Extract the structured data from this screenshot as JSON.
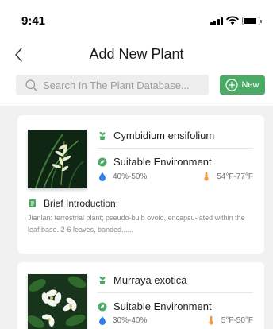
{
  "status_bar": {
    "time": "9:41"
  },
  "header": {
    "title": "Add New Plant",
    "search_placeholder": "Search In The Plant Database...",
    "new_button_label": "New"
  },
  "colors": {
    "accent_green": "#4aaa66",
    "water_blue": "#2f80ed",
    "temp_orange": "#f2994a"
  },
  "icons": {
    "back": "chevron-left-icon",
    "search": "search-icon",
    "new": "plus-circle-icon",
    "plant": "plant-pot-icon",
    "environment": "sun-leaf-icon",
    "humidity": "water-drop-icon",
    "temperature": "thermometer-icon",
    "intro": "book-icon"
  },
  "plants": [
    {
      "name": "Cymbidium ensifolium",
      "environment_label": "Suitable Environment",
      "humidity": "40%-50%",
      "temperature": "54°F-77°F",
      "intro_label": "Brief Introduction:",
      "intro_text": "Jianlan: terrestrial plant; pseudo-bulb ovoid, encapsu-lated within the leaf base. 2-6 leaves, banded......"
    },
    {
      "name": "Murraya exotica",
      "environment_label": "Suitable Environment",
      "humidity": "30%-40%",
      "temperature": "5°F-50°F"
    }
  ]
}
